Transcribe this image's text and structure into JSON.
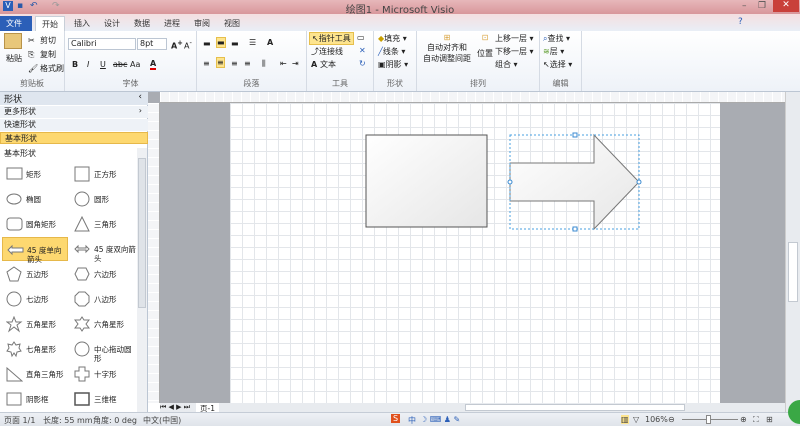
{
  "window": {
    "title": "绘图1 - Microsoft Visio"
  },
  "tabs": [
    "文件",
    "开始",
    "插入",
    "设计",
    "数据",
    "进程",
    "审阅",
    "视图"
  ],
  "ribbon": {
    "clipboard": {
      "label": "剪贴板",
      "paste": "粘贴",
      "cut": "剪切",
      "copy": "复制",
      "format_painter": "格式刷"
    },
    "font": {
      "label": "字体",
      "font_name": "Calibri",
      "font_size": "8pt",
      "bold": "B",
      "italic": "I",
      "underline": "U",
      "strike": "abc",
      "case": "Aa"
    },
    "paragraph": {
      "label": "段落"
    },
    "tools": {
      "label": "工具",
      "pointer": "指针工具",
      "connector": "连接线",
      "text": "文本"
    },
    "shape": {
      "label": "形状",
      "fill": "填充",
      "line": "线条",
      "shadow": "阴影"
    },
    "arrange": {
      "label": "排列",
      "auto_align": "自动对齐和",
      "auto_space": "自动调整间距",
      "position": "位置",
      "bring_forward": "上移一层",
      "send_backward": "下移一层",
      "group": "组合"
    },
    "editing": {
      "label": "编辑",
      "find": "查找",
      "layer": "层",
      "select": "选择"
    }
  },
  "shapes_pane": {
    "title": "形状",
    "more": "更多形状",
    "quick": "快速形状",
    "basic": "基本形状",
    "section": "基本形状",
    "items": [
      "矩形",
      "正方形",
      "椭圆",
      "圆形",
      "圆角矩形",
      "三角形",
      "45 度单向箭头",
      "45 度双向箭头",
      "五边形",
      "六边形",
      "七边形",
      "八边形",
      "五角星形",
      "六角星形",
      "七角星形",
      "中心拖动圆形",
      "直角三角形",
      "十字形",
      "阴影框",
      "三维框"
    ]
  },
  "page_tab": "页-1",
  "status": {
    "page": "页面 1/1",
    "length": "长度: 55 mm",
    "angle": "角度: 0 deg",
    "language": "中文(中国)",
    "zoom": "106%"
  },
  "ime": {
    "mode": "中"
  }
}
